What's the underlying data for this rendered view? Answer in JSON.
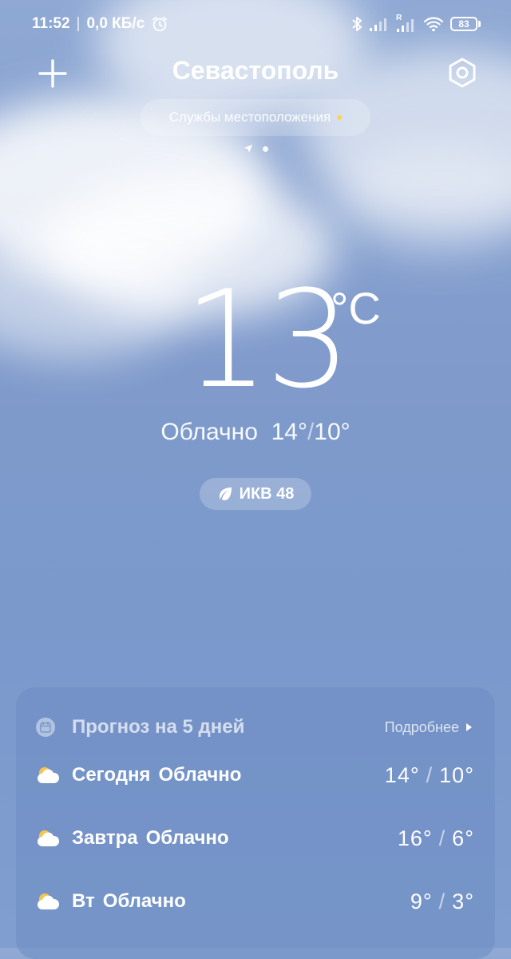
{
  "status_bar": {
    "time": "11:52",
    "net_speed": "0,0 КБ/с",
    "signal_roaming": "R",
    "battery": "83"
  },
  "header": {
    "city": "Севастополь",
    "location_services": "Службы местоположения"
  },
  "current": {
    "temperature": "13",
    "unit": "°C",
    "condition": "Облачно",
    "high": "14°",
    "low": "10°",
    "aqi": "ИКВ 48"
  },
  "forecast": {
    "title": "Прогноз на 5 дней",
    "more": "Подробнее",
    "days": [
      {
        "day": "Сегодня",
        "condition": "Облачно",
        "high": "14°",
        "low": "10°"
      },
      {
        "day": "Завтра",
        "condition": "Облачно",
        "high": "16°",
        "low": "6°"
      },
      {
        "day": "Вт",
        "condition": "Облачно",
        "high": "9°",
        "low": "3°"
      }
    ]
  },
  "colors": {
    "sky": "#7f9acb",
    "accent_dot": "#ffd34d",
    "sun": "#f6c451"
  }
}
